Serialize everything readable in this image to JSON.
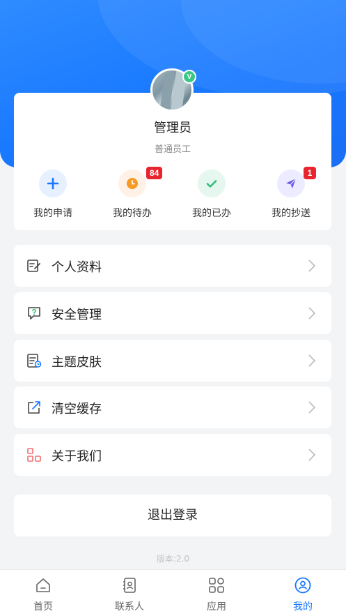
{
  "profile": {
    "name": "管理员",
    "role": "普通员工",
    "verified_mark": "V"
  },
  "quick_actions": [
    {
      "label": "我的申请",
      "icon": "plus-icon",
      "badge": ""
    },
    {
      "label": "我的待办",
      "icon": "clock-icon",
      "badge": "84"
    },
    {
      "label": "我的已办",
      "icon": "check-icon",
      "badge": ""
    },
    {
      "label": "我的抄送",
      "icon": "send-icon",
      "badge": "1"
    }
  ],
  "menu": [
    {
      "label": "个人资料",
      "icon": "edit-document-icon"
    },
    {
      "label": "安全管理",
      "icon": "help-chat-icon"
    },
    {
      "label": "主题皮肤",
      "icon": "theme-list-icon"
    },
    {
      "label": "清空缓存",
      "icon": "share-out-icon"
    },
    {
      "label": "关于我们",
      "icon": "grid-blocks-icon"
    }
  ],
  "logout_label": "退出登录",
  "version": "版本:2.0",
  "tabbar": {
    "tabs": [
      {
        "label": "首页",
        "icon": "home-icon",
        "active": false
      },
      {
        "label": "联系人",
        "icon": "contacts-icon",
        "active": false
      },
      {
        "label": "应用",
        "icon": "apps-icon",
        "active": false
      },
      {
        "label": "我的",
        "icon": "user-circle-icon",
        "active": true
      }
    ]
  },
  "colors": {
    "primary": "#1677ff",
    "badge": "#e8242f",
    "verified": "#3cc787"
  }
}
